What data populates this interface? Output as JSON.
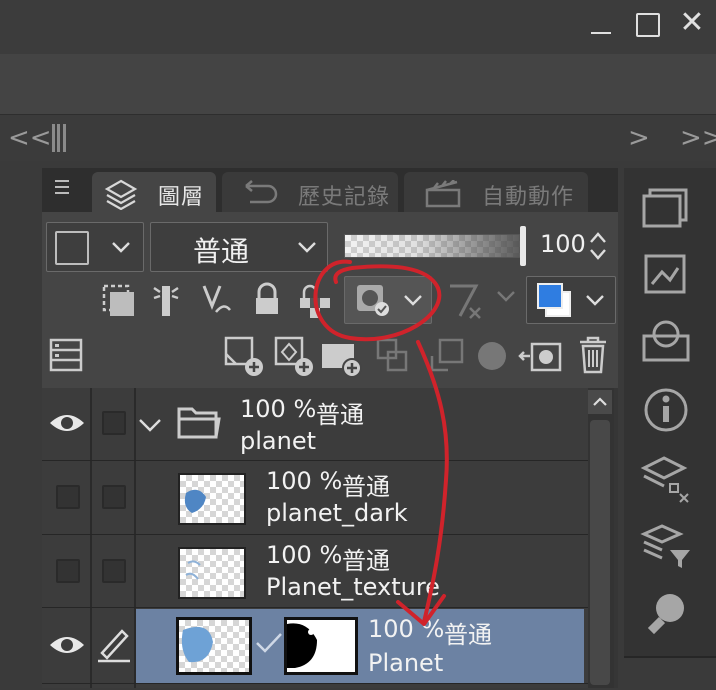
{
  "window": {
    "minimize_icon": "minimize-icon",
    "maximize_icon": "maximize-icon",
    "close_glyph": "✕"
  },
  "dockbar": {
    "collapse_left": "<<",
    "expand_right": ">>",
    "nav_right": ">"
  },
  "tabs": [
    {
      "label": "圖層",
      "icon": "layers-icon",
      "active": true
    },
    {
      "label": "歷史記錄",
      "icon": "history-icon",
      "active": false
    },
    {
      "label": "自動動作",
      "icon": "clapper-icon",
      "active": false
    }
  ],
  "toolbar": {
    "blend_mode": "普通",
    "opacity_value": "100",
    "opacity_percent": 100
  },
  "layers": [
    {
      "percent": "100 %",
      "mode": "普通",
      "name": "planet",
      "type": "folder",
      "visible": true,
      "expanded": true
    },
    {
      "percent": "100 %",
      "mode": "普通",
      "name": "planet_dark",
      "type": "raster",
      "visible": false
    },
    {
      "percent": "100 %",
      "mode": "普通",
      "name": "Planet_texture",
      "type": "raster",
      "visible": false
    },
    {
      "percent": "100 %",
      "mode": "普通",
      "name": "Planet",
      "type": "raster",
      "visible": true,
      "selected": true,
      "has_mask": true
    }
  ],
  "colors": {
    "selection": "#6c82a3",
    "annotation": "#d0232b",
    "accent_blue": "#2f7de1"
  }
}
